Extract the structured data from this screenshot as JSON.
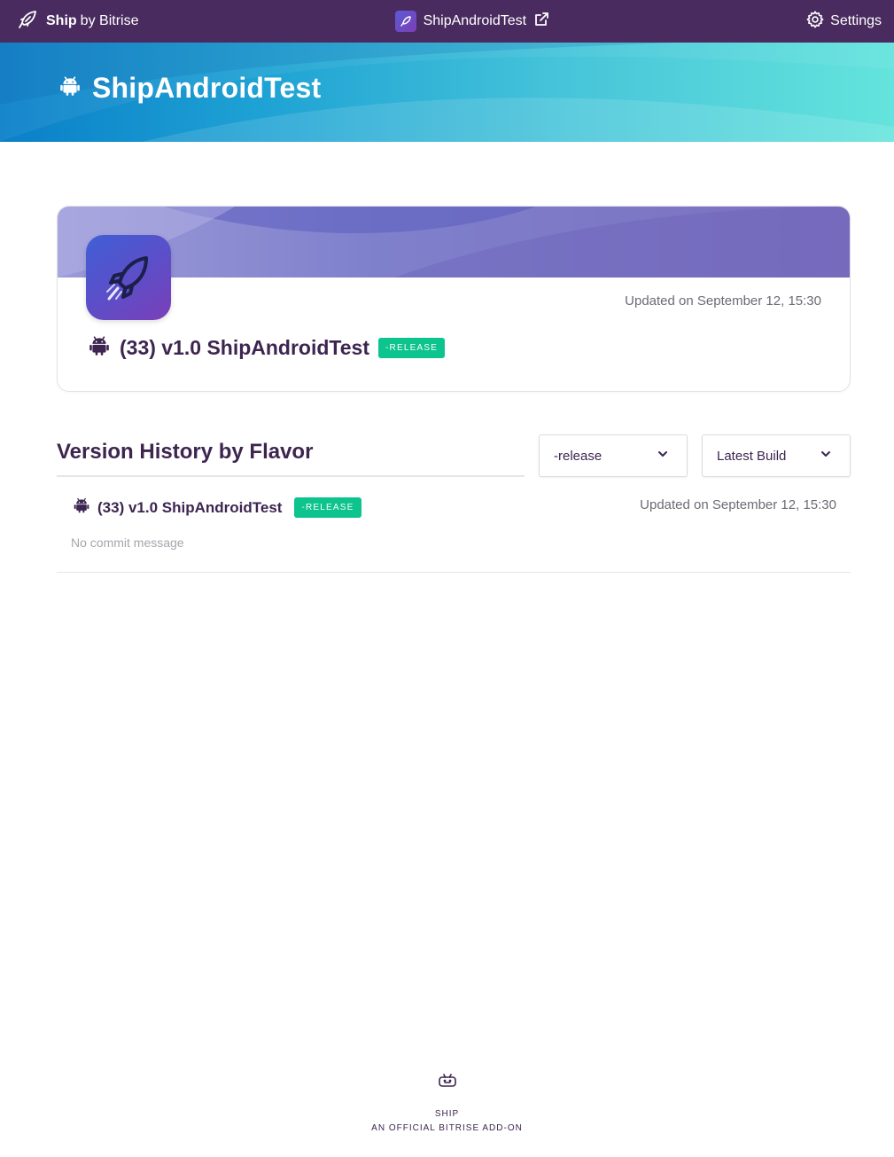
{
  "nav": {
    "brand_strong": "Ship",
    "brand_light": "by Bitrise",
    "app_name": "ShipAndroidTest",
    "settings_label": "Settings"
  },
  "hero": {
    "title": "ShipAndroidTest"
  },
  "card": {
    "updated": "Updated on September 12, 15:30",
    "build_title": "(33) v1.0 ShipAndroidTest",
    "badge": "-RELEASE"
  },
  "version_history": {
    "title": "Version History by Flavor",
    "flavor_select": "-release",
    "build_select": "Latest Build",
    "rows": [
      {
        "build_title": "(33) v1.0 ShipAndroidTest",
        "badge": "-RELEASE",
        "updated": "Updated on September 12, 15:30",
        "commit": "No commit message"
      }
    ]
  },
  "footer": {
    "line1": "SHIP",
    "line2": "AN OFFICIAL BITRISE ADD-ON"
  },
  "colors": {
    "nav_bg": "#4a2b5f",
    "text_primary": "#3d2550",
    "badge_green": "#0dc38e",
    "hero_start": "#0a7fc8",
    "hero_end": "#64e4dc"
  },
  "icons": {
    "brand": "rocket-leaf-icon",
    "external": "external-link-icon",
    "settings": "gear-icon",
    "platform": "android-icon",
    "dropdown": "chevron-down-icon",
    "footer": "ship-logo-icon"
  }
}
